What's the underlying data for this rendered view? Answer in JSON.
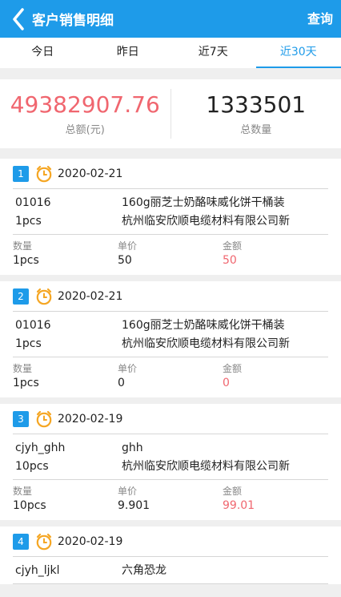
{
  "header": {
    "title": "客户销售明细",
    "action_label": "查询"
  },
  "tabs": [
    {
      "label": "今日",
      "active": false
    },
    {
      "label": "昨日",
      "active": false
    },
    {
      "label": "近7天",
      "active": false
    },
    {
      "label": "近30天",
      "active": true
    }
  ],
  "summary": {
    "total_amount": "49382907.76",
    "total_amount_label": "总额(元)",
    "total_quantity": "1333501",
    "total_quantity_label": "总数量"
  },
  "meta_labels": {
    "quantity": "数量",
    "price": "单价",
    "amount": "金额"
  },
  "records": [
    {
      "index": "1",
      "date": "2020-02-21",
      "code": "01016",
      "product": "160g丽芝士奶酪味威化饼干桶装",
      "unit_qty": "1pcs",
      "customer": "杭州临安欣顺电缆材料有限公司新",
      "quantity": "1pcs",
      "price": "50",
      "amount": "50"
    },
    {
      "index": "2",
      "date": "2020-02-21",
      "code": "01016",
      "product": "160g丽芝士奶酪味威化饼干桶装",
      "unit_qty": "1pcs",
      "customer": "杭州临安欣顺电缆材料有限公司新",
      "quantity": "1pcs",
      "price": "0",
      "amount": "0"
    },
    {
      "index": "3",
      "date": "2020-02-19",
      "code": "cjyh_ghh",
      "product": "ghh",
      "unit_qty": "10pcs",
      "customer": "杭州临安欣顺电缆材料有限公司新",
      "quantity": "10pcs",
      "price": "9.901",
      "amount": "99.01"
    },
    {
      "index": "4",
      "date": "2020-02-19",
      "code": "cjyh_ljkl",
      "product": "六角恐龙",
      "unit_qty": "",
      "customer": "",
      "quantity": "",
      "price": "",
      "amount": ""
    }
  ],
  "colors": {
    "accent": "#1e9be9",
    "amount_red": "#f0666f",
    "clock_orange": "#f5a623"
  }
}
